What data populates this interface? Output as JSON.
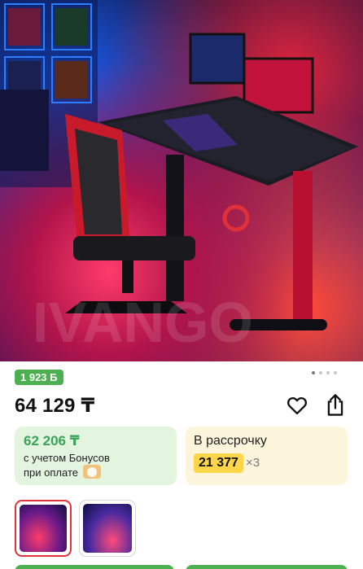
{
  "product": {
    "image_alt": "Gaming desk with RGB lighting and red gaming chair"
  },
  "gallery": {
    "dots_count": 4,
    "active_index": 0
  },
  "bonus_pill": "1 923 Б",
  "price": "64 129 ₸",
  "offers": {
    "bonus": {
      "amount": "62 206 ₸",
      "line1": "с учетом Бонусов",
      "line2": "при оплате"
    },
    "installment": {
      "label": "В рассрочку",
      "amount": "21 377",
      "multiplier": "×3"
    }
  },
  "icons": {
    "favorite": "heart-icon",
    "share": "share-icon"
  },
  "colors": {
    "accent_green": "#4caf50",
    "installment_yellow": "#ffd64a",
    "selected_border": "#e0343c"
  }
}
